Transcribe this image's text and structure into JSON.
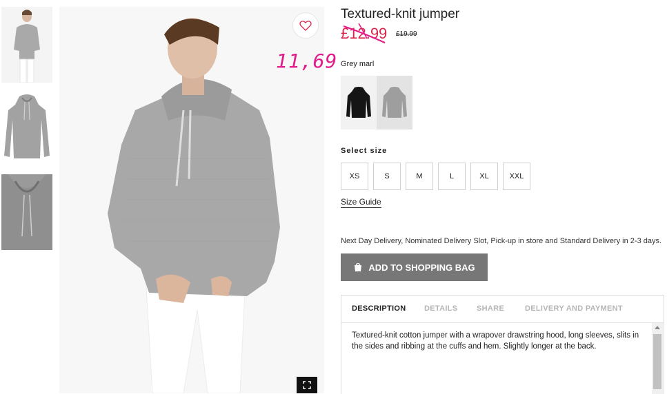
{
  "product": {
    "title": "Textured-knit jumper",
    "price_current": "£12.99",
    "price_original": "£19.99",
    "handwritten_price": "11,69",
    "colour_name": "Grey marl"
  },
  "colours": {
    "accent_sale": "#d8264c",
    "handwritten": "#e21a8a",
    "button_bg": "#777777"
  },
  "swatches": [
    {
      "name": "Black"
    },
    {
      "name": "Grey marl"
    }
  ],
  "size": {
    "label": "Select size",
    "options": [
      "XS",
      "S",
      "M",
      "L",
      "XL",
      "XXL"
    ],
    "guide_link": "Size Guide"
  },
  "delivery_note": "Next Day Delivery, Nominated Delivery Slot, Pick-up in store and Standard Delivery in 2-3 days.",
  "add_to_bag_label": "ADD TO SHOPPING BAG",
  "tabs": [
    "DESCRIPTION",
    "DETAILS",
    "SHARE",
    "DELIVERY AND PAYMENT"
  ],
  "description": "Textured-knit cotton jumper with a wrapover drawstring hood, long sleeves, slits in the sides and ribbing at the cuffs and hem. Slightly longer at the back.",
  "icons": {
    "favourite": "heart-icon",
    "fullscreen": "fullscreen-icon",
    "bag": "shopping-bag-icon"
  }
}
